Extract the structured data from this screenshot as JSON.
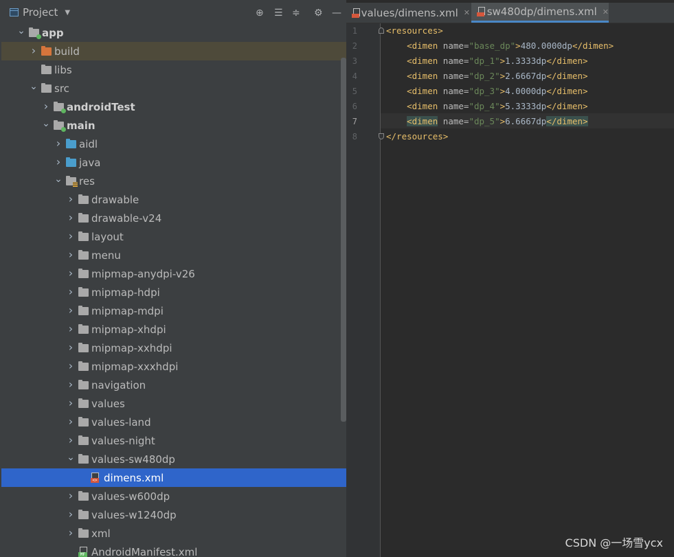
{
  "project_panel": {
    "title": "Project",
    "toolbar_icons": [
      "locate-icon",
      "expand-all-icon",
      "collapse-all-icon",
      "gear-icon",
      "minimize-icon"
    ],
    "tree": [
      {
        "label": "app",
        "depth": 0,
        "expanded": true,
        "icon": "module-folder",
        "bold": true
      },
      {
        "label": "build",
        "depth": 1,
        "expanded": false,
        "icon": "orange-folder",
        "highlight": true
      },
      {
        "label": "libs",
        "depth": 1,
        "leaf": true,
        "icon": "gray-folder"
      },
      {
        "label": "src",
        "depth": 1,
        "expanded": true,
        "icon": "gray-folder"
      },
      {
        "label": "androidTest",
        "depth": 2,
        "expanded": false,
        "icon": "source-folder",
        "bold": true
      },
      {
        "label": "main",
        "depth": 2,
        "expanded": true,
        "icon": "source-folder",
        "bold": true
      },
      {
        "label": "aidl",
        "depth": 3,
        "expanded": false,
        "icon": "blue-folder"
      },
      {
        "label": "java",
        "depth": 3,
        "expanded": false,
        "icon": "blue-folder"
      },
      {
        "label": "res",
        "depth": 3,
        "expanded": true,
        "icon": "res-folder"
      },
      {
        "label": "drawable",
        "depth": 4,
        "expanded": false,
        "icon": "gray-folder"
      },
      {
        "label": "drawable-v24",
        "depth": 4,
        "expanded": false,
        "icon": "gray-folder"
      },
      {
        "label": "layout",
        "depth": 4,
        "expanded": false,
        "icon": "gray-folder"
      },
      {
        "label": "menu",
        "depth": 4,
        "expanded": false,
        "icon": "gray-folder"
      },
      {
        "label": "mipmap-anydpi-v26",
        "depth": 4,
        "expanded": false,
        "icon": "gray-folder"
      },
      {
        "label": "mipmap-hdpi",
        "depth": 4,
        "expanded": false,
        "icon": "gray-folder"
      },
      {
        "label": "mipmap-mdpi",
        "depth": 4,
        "expanded": false,
        "icon": "gray-folder"
      },
      {
        "label": "mipmap-xhdpi",
        "depth": 4,
        "expanded": false,
        "icon": "gray-folder"
      },
      {
        "label": "mipmap-xxhdpi",
        "depth": 4,
        "expanded": false,
        "icon": "gray-folder"
      },
      {
        "label": "mipmap-xxxhdpi",
        "depth": 4,
        "expanded": false,
        "icon": "gray-folder"
      },
      {
        "label": "navigation",
        "depth": 4,
        "expanded": false,
        "icon": "gray-folder"
      },
      {
        "label": "values",
        "depth": 4,
        "expanded": false,
        "icon": "gray-folder"
      },
      {
        "label": "values-land",
        "depth": 4,
        "expanded": false,
        "icon": "gray-folder"
      },
      {
        "label": "values-night",
        "depth": 4,
        "expanded": false,
        "icon": "gray-folder"
      },
      {
        "label": "values-sw480dp",
        "depth": 4,
        "expanded": true,
        "icon": "gray-folder"
      },
      {
        "label": "dimens.xml",
        "depth": 5,
        "leaf": true,
        "icon": "xml-file",
        "selected": true
      },
      {
        "label": "values-w600dp",
        "depth": 4,
        "expanded": false,
        "icon": "gray-folder"
      },
      {
        "label": "values-w1240dp",
        "depth": 4,
        "expanded": false,
        "icon": "gray-folder"
      },
      {
        "label": "xml",
        "depth": 4,
        "expanded": false,
        "icon": "gray-folder"
      },
      {
        "label": "AndroidManifest.xml",
        "depth": 4,
        "leaf": true,
        "icon": "manifest-file"
      }
    ]
  },
  "editor": {
    "tabs": [
      {
        "label": "values/dimens.xml",
        "active": false
      },
      {
        "label": "sw480dp/dimens.xml",
        "active": true
      }
    ],
    "current_line": 7,
    "lines": [
      {
        "n": "1",
        "tokens": [
          [
            "t",
            "<resources>"
          ]
        ]
      },
      {
        "n": "2",
        "tokens": [
          [
            "x",
            "    "
          ],
          [
            "t",
            "<dimen "
          ],
          [
            "a",
            "name="
          ],
          [
            "v",
            "\"base_dp\""
          ],
          [
            "t",
            ">"
          ],
          [
            "x",
            "480.0000dp"
          ],
          [
            "t",
            "</dimen>"
          ]
        ]
      },
      {
        "n": "3",
        "tokens": [
          [
            "x",
            "    "
          ],
          [
            "t",
            "<dimen "
          ],
          [
            "a",
            "name="
          ],
          [
            "v",
            "\"dp_1\""
          ],
          [
            "t",
            ">"
          ],
          [
            "x",
            "1.3333dp"
          ],
          [
            "t",
            "</dimen>"
          ]
        ]
      },
      {
        "n": "4",
        "tokens": [
          [
            "x",
            "    "
          ],
          [
            "t",
            "<dimen "
          ],
          [
            "a",
            "name="
          ],
          [
            "v",
            "\"dp_2\""
          ],
          [
            "t",
            ">"
          ],
          [
            "x",
            "2.6667dp"
          ],
          [
            "t",
            "</dimen>"
          ]
        ]
      },
      {
        "n": "5",
        "tokens": [
          [
            "x",
            "    "
          ],
          [
            "t",
            "<dimen "
          ],
          [
            "a",
            "name="
          ],
          [
            "v",
            "\"dp_3\""
          ],
          [
            "t",
            ">"
          ],
          [
            "x",
            "4.0000dp"
          ],
          [
            "t",
            "</dimen>"
          ]
        ]
      },
      {
        "n": "6",
        "tokens": [
          [
            "x",
            "    "
          ],
          [
            "t",
            "<dimen "
          ],
          [
            "a",
            "name="
          ],
          [
            "v",
            "\"dp_4\""
          ],
          [
            "t",
            ">"
          ],
          [
            "x",
            "5.3333dp"
          ],
          [
            "t",
            "</dimen>"
          ]
        ]
      },
      {
        "n": "7",
        "tokens": [
          [
            "x",
            "    "
          ],
          [
            "tm",
            "<dimen"
          ],
          [
            "t",
            " "
          ],
          [
            "a",
            "name="
          ],
          [
            "v",
            "\"dp_5\""
          ],
          [
            "t",
            ">"
          ],
          [
            "x",
            "6.6667dp"
          ],
          [
            "tm",
            "</dimen>"
          ]
        ]
      },
      {
        "n": "8",
        "tokens": [
          [
            "t",
            "</resources>"
          ]
        ]
      }
    ]
  },
  "watermark": "CSDN @一场雪ycx"
}
